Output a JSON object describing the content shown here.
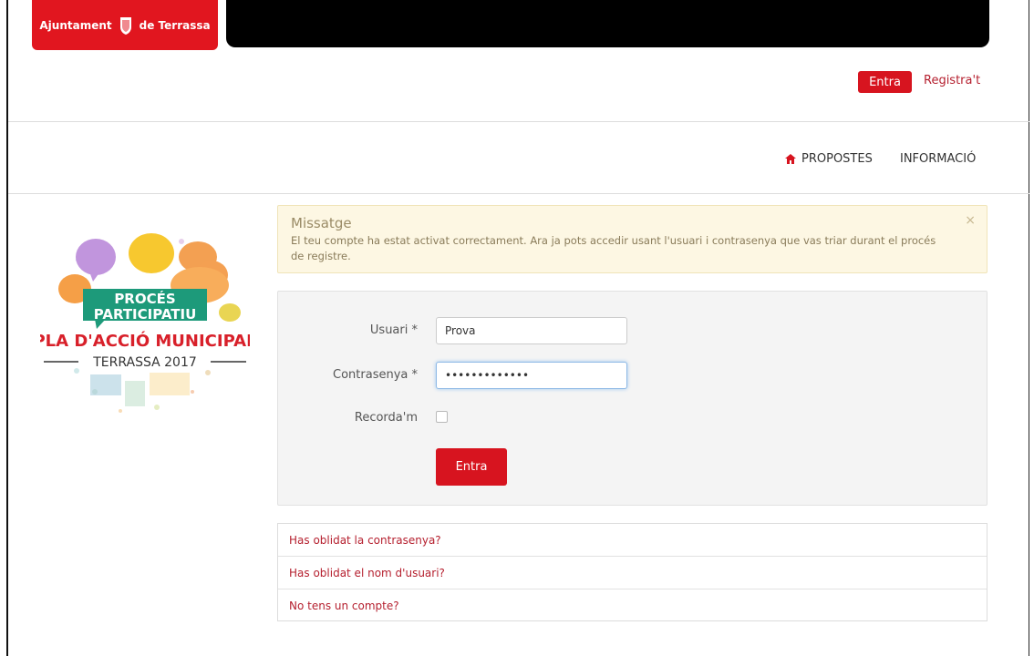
{
  "header": {
    "municipality_before": "Ajuntament",
    "municipality_after": "de Terrassa",
    "login_button": "Entra",
    "register_link": "Registra't"
  },
  "nav": {
    "propostes": "PROPOSTES",
    "informacio": "INFORMACIÓ"
  },
  "logo": {
    "line1": "PROCÉS",
    "line2": "PARTICIPATIU",
    "line3": "PLA D'ACCIÓ MUNICIPAL",
    "line4": "TERRASSA 2017"
  },
  "message": {
    "title": "Missatge",
    "text": "El teu compte ha estat activat correctament. Ara ja pots accedir usant l'usuari i contrasenya que vas triar durant el procés de registre.",
    "close": "×"
  },
  "form": {
    "username_label": "Usuari *",
    "username_value": "Prova",
    "password_label": "Contrasenya *",
    "password_value": "•••••••••••••",
    "remember_label": "Recorda'm",
    "submit_label": "Entra"
  },
  "links": [
    {
      "label": "Has oblidat la contrasenya?"
    },
    {
      "label": "Has oblidat el nom d'usuari?"
    },
    {
      "label": "No tens un compte?"
    }
  ],
  "colors": {
    "primary": "#d7141f",
    "link": "#b51f2e",
    "alert_bg": "#fdf7e3"
  }
}
